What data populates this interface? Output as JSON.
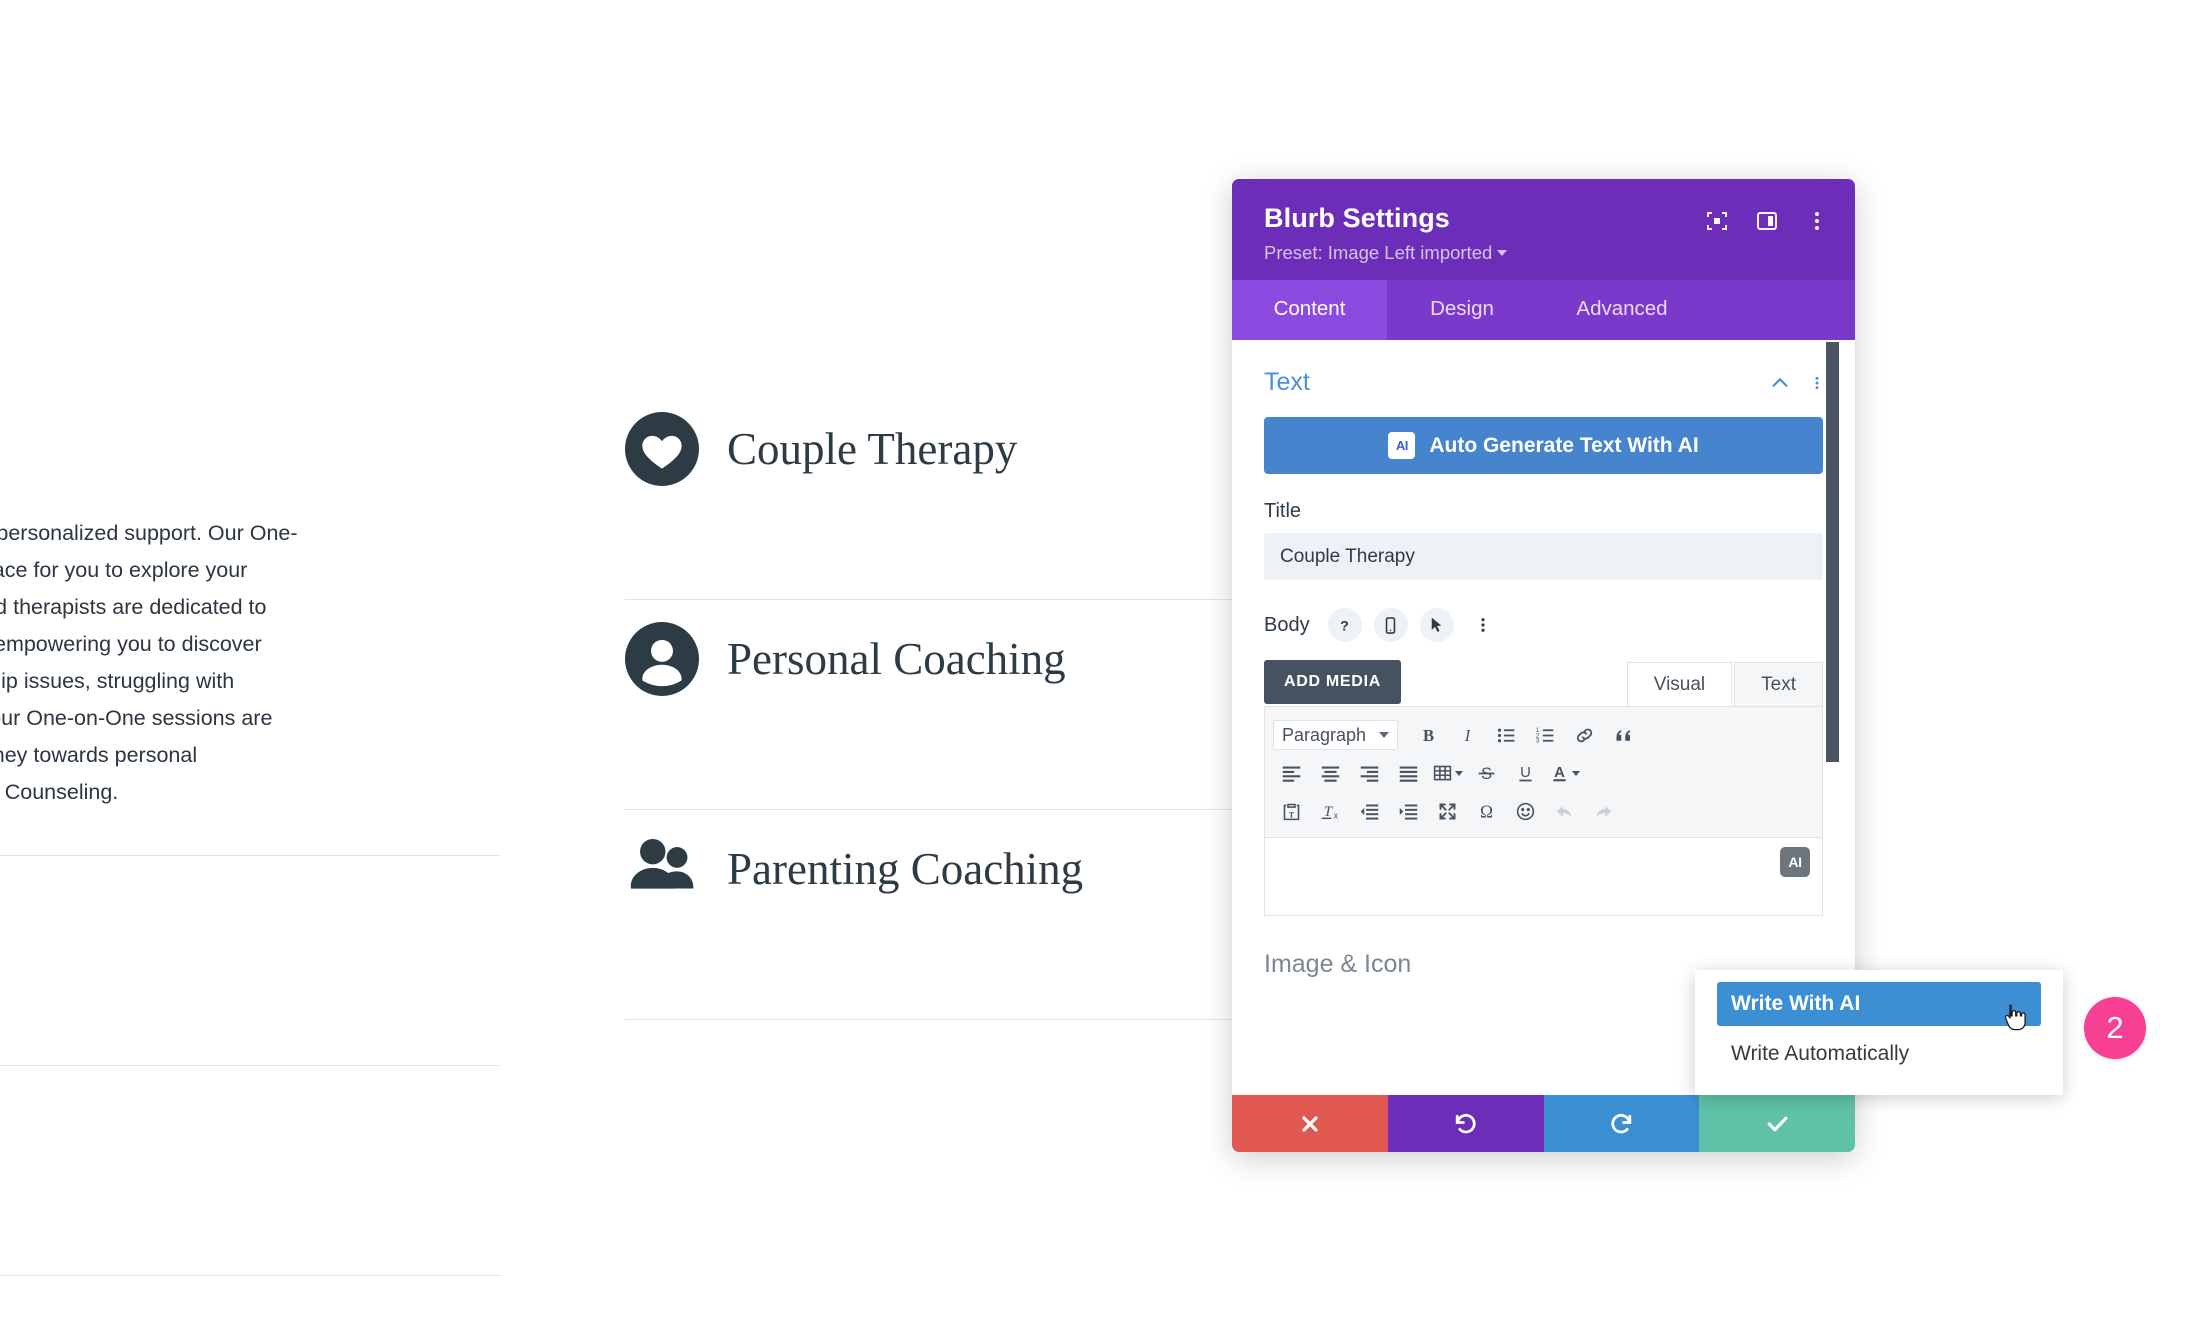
{
  "page": {
    "left_paragraph": "e power of personalized support. Our One-\nfidential space for you to explore your\nexperienced therapists are dedicated to\nnd downs, empowering you to discover\ng relationship issues, struggling with\nal growth, our One-on-One sessions are\nrt your journey towards personal\nh Compass Counseling.",
    "blurbs": [
      {
        "title": "Couple Therapy",
        "icon": "heart-icon"
      },
      {
        "title": "Personal Coaching",
        "icon": "person-icon"
      },
      {
        "title": "Parenting Coaching",
        "icon": "people-icon"
      }
    ]
  },
  "modal": {
    "title": "Blurb Settings",
    "preset": "Preset: Image Left imported",
    "header_icons": [
      {
        "name": "focus-target-icon"
      },
      {
        "name": "panel-layout-icon"
      },
      {
        "name": "kebab-menu-icon"
      }
    ],
    "tabs": [
      {
        "label": "Content",
        "active": true
      },
      {
        "label": "Design",
        "active": false
      },
      {
        "label": "Advanced",
        "active": false
      }
    ],
    "text_section": {
      "title": "Text",
      "ai_button": {
        "label": "Auto Generate Text With AI",
        "chip": "AI"
      },
      "title_field": {
        "label": "Title",
        "value": "Couple Therapy"
      },
      "body_field": {
        "label": "Body",
        "icons": [
          "help-icon",
          "mobile-icon",
          "pointer-icon",
          "kebab-menu-icon"
        ]
      },
      "editor": {
        "add_media": "ADD MEDIA",
        "tabs": [
          {
            "label": "Visual",
            "active": true
          },
          {
            "label": "Text",
            "active": false
          }
        ],
        "format_select": "Paragraph",
        "ai_chip": "AI"
      }
    },
    "next_section": "Image & Icon",
    "footer": [
      {
        "name": "cancel-button",
        "icon": "close-icon",
        "color": "#e0584f"
      },
      {
        "name": "undo-button",
        "icon": "undo-icon",
        "color": "#6c2eb9"
      },
      {
        "name": "redo-button",
        "icon": "redo-icon",
        "color": "#3d8fd4"
      },
      {
        "name": "save-button",
        "icon": "check-icon",
        "color": "#5fc2a6"
      }
    ]
  },
  "ai_dropdown": {
    "items": [
      {
        "label": "Write With AI",
        "selected": true
      },
      {
        "label": "Write Automatically",
        "selected": false
      }
    ]
  },
  "annotation": {
    "step_number": "2",
    "color": "#f73f94"
  }
}
